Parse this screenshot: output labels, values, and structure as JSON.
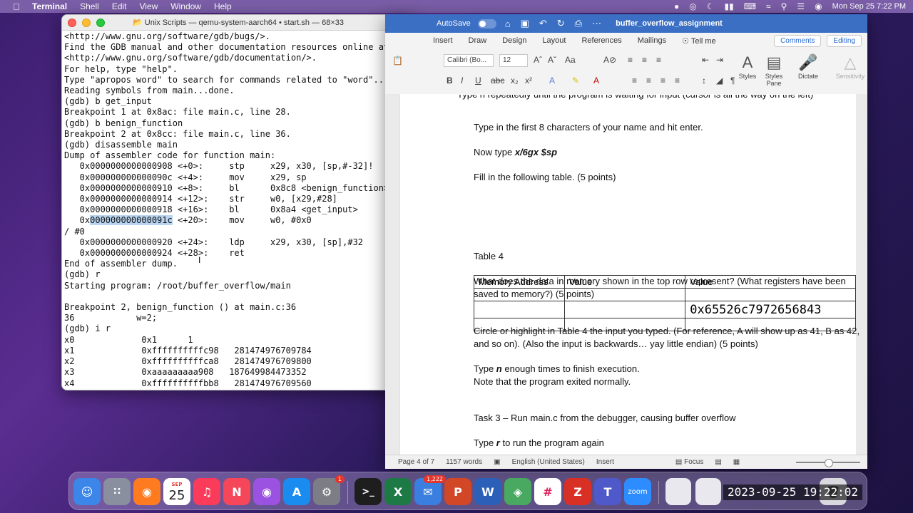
{
  "menubar": {
    "app": "Terminal",
    "items": [
      "Shell",
      "Edit",
      "View",
      "Window",
      "Help"
    ],
    "clock": "Mon Sep 25  7:22 PM"
  },
  "terminal": {
    "title": "Unix Scripts — qemu-system-aarch64 • start.sh — 68×33",
    "lines": [
      "<http://www.gnu.org/software/gdb/bugs/>.",
      "Find the GDB manual and other documentation resources online at:",
      "<http://www.gnu.org/software/gdb/documentation/>.",
      "For help, type \"help\".",
      "Type \"apropos word\" to search for commands related to \"word\"...",
      "Reading symbols from main...done.",
      "(gdb) b get_input",
      "Breakpoint 1 at 0x8ac: file main.c, line 28.",
      "(gdb) b benign_function",
      "Breakpoint 2 at 0x8cc: file main.c, line 36.",
      "(gdb) disassemble main",
      "Dump of assembler code for function main:",
      "   0x0000000000000908 <+0>:     stp     x29, x30, [sp,#-32]!",
      "   0x000000000000090c <+4>:     mov     x29, sp",
      "   0x0000000000000910 <+8>:     bl      0x8c8 <benign_function>",
      "   0x0000000000000914 <+12>:    str     w0, [x29,#28]",
      "   0x0000000000000918 <+16>:    bl      0x8a4 <get_input>",
      "   0x000000000000091c <+20>:    mov     w0, #0x0                   /",
      "/ #0",
      "   0x0000000000000920 <+24>:    ldp     x29, x30, [sp],#32",
      "   0x0000000000000924 <+28>:    ret",
      "End of assembler dump.",
      "(gdb) r",
      "Starting program: /root/buffer_overflow/main",
      "",
      "Breakpoint 2, benign_function () at main.c:36",
      "36            w=2;",
      "(gdb) i r",
      "x0             0x1      1",
      "x1             0xffffffffffc98   281474976709784",
      "x2             0xffffffffffca8   281474976709800",
      "x3             0xaaaaaaaaa908   187649984473352",
      "x4             0xffffffffffbb8   281474976709560"
    ]
  },
  "word": {
    "autosave": "AutoSave",
    "autosave_state": "OFF",
    "doc_name": "buffer_overflow_assignment",
    "tabs": [
      "Insert",
      "Draw",
      "Design",
      "Layout",
      "References",
      "Mailings",
      "Tell me"
    ],
    "comments_btn": "Comments",
    "editing_btn": "Editing",
    "font_name": "Calibri (Bo...",
    "font_size": "12",
    "ribbon_labels": [
      "Styles",
      "Styles Pane",
      "Dictate",
      "Sensitivity"
    ],
    "top_cut_line": "Type n repeatedly until the program is waiting for input (cursor is all the way on the left)",
    "para1": "Type in the first 8 characters of your name and hit enter.",
    "para2_prefix": "Now type ",
    "para2_cmd": "x/6gx $sp",
    "para3": "Fill in the following table. (5 points)",
    "table": {
      "headers": [
        "Memory Address",
        "Value",
        "Value"
      ],
      "value_cell": "0x65526c7972656843"
    },
    "table_caption": "Table 4",
    "para4": "What does the data in memory shown in the top row represent?  (What registers have been saved to memory?) (5 points)",
    "para5": "Circle or highlight in Table 4 the input you typed. (For reference, A will show up as 41, B as 42, and so on).  (Also the input is backwards… yay little endian) (5 points)",
    "para6_prefix": "Type ",
    "para6_cmd": "n",
    "para6_rest": " enough times to finish execution.",
    "para7": "Note that the program exited normally.",
    "task3": "Task 3 – Run main.c from the debugger, causing buffer overflow",
    "para8_prefix": "Type ",
    "para8_cmd": "r",
    "para8_rest": " to run the program again",
    "status": {
      "page": "Page 4 of 7",
      "words": "1157 words",
      "lang": "English (United States)",
      "mode": "Insert",
      "focus": "Focus"
    }
  },
  "dock": {
    "calendar_month": "SEP",
    "calendar_day": "25",
    "mail_badge": "1,222",
    "settings_badge": "1",
    "zoom_label": "zoom"
  },
  "timestamp": "2023-09-25 19:22:02"
}
